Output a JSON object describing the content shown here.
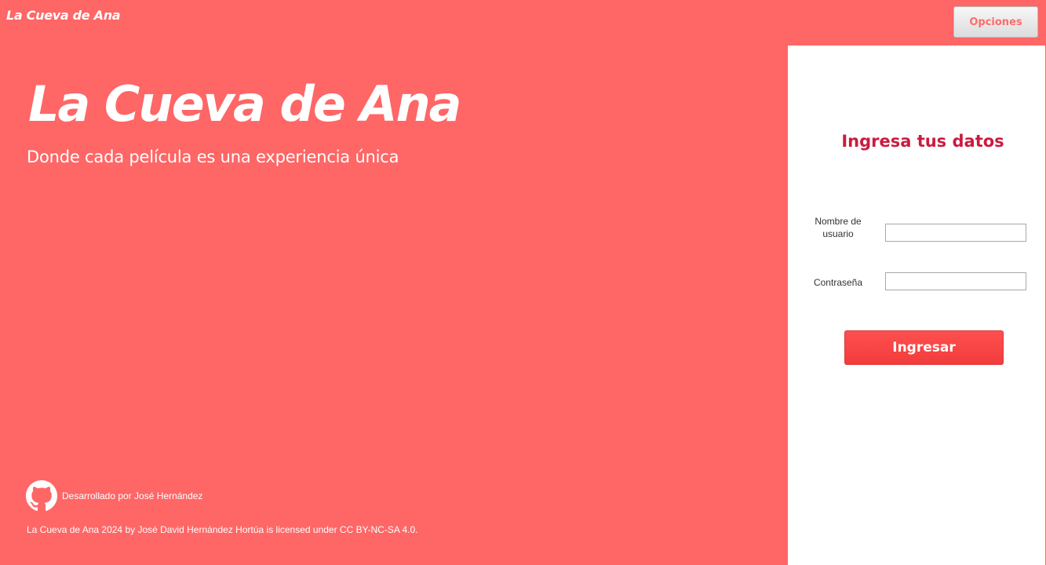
{
  "window": {
    "title": "La Cueva de Ana",
    "options_label": "Opciones"
  },
  "hero": {
    "title": "La Cueva de Ana",
    "subtitle": "Donde cada película es una experiencia única"
  },
  "footer": {
    "github_icon": "github-icon",
    "developer_credit": "Desarrollado por José Hernández",
    "license": "La Cueva de Ana 2024 by José David Hernández Hortúa is licensed under CC BY-NC-SA 4.0."
  },
  "login": {
    "heading": "Ingresa tus datos",
    "username_label": "Nombre de usuario",
    "username_value": "",
    "password_label": "Contraseña",
    "password_value": "",
    "submit_label": "Ingresar"
  },
  "colors": {
    "background": "#ff6666",
    "panel": "#ffffff",
    "heading": "#cc1a3e",
    "button": "#f54444"
  }
}
